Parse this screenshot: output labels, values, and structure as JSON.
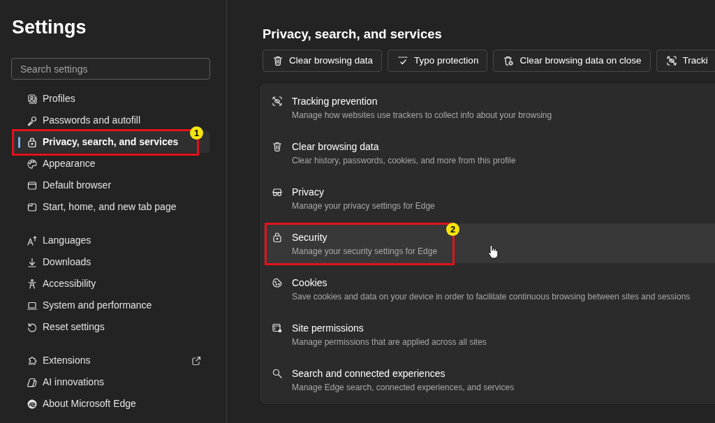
{
  "sidebar": {
    "title": "Settings",
    "search": {
      "placeholder": "Search settings"
    },
    "groups": [
      {
        "items": [
          {
            "label": "Profiles",
            "selected": false,
            "external": false
          },
          {
            "label": "Passwords and autofill",
            "selected": false,
            "external": false
          },
          {
            "label": "Privacy, search, and services",
            "selected": true,
            "external": false,
            "callout": "1"
          },
          {
            "label": "Appearance",
            "selected": false,
            "external": false
          },
          {
            "label": "Default browser",
            "selected": false,
            "external": false
          },
          {
            "label": "Start, home, and new tab page",
            "selected": false,
            "external": false
          }
        ]
      },
      {
        "items": [
          {
            "label": "Languages",
            "selected": false,
            "external": false
          },
          {
            "label": "Downloads",
            "selected": false,
            "external": false
          },
          {
            "label": "Accessibility",
            "selected": false,
            "external": false
          },
          {
            "label": "System and performance",
            "selected": false,
            "external": false
          },
          {
            "label": "Reset settings",
            "selected": false,
            "external": false
          }
        ]
      },
      {
        "items": [
          {
            "label": "Extensions",
            "selected": false,
            "external": true
          },
          {
            "label": "AI innovations",
            "selected": false,
            "external": false
          },
          {
            "label": "About Microsoft Edge",
            "selected": false,
            "external": false
          }
        ]
      }
    ]
  },
  "main": {
    "heading": "Privacy, search, and services",
    "quick_links": [
      {
        "label": "Clear browsing data"
      },
      {
        "label": "Typo protection"
      },
      {
        "label": "Clear browsing data on close"
      },
      {
        "label": "Tracki"
      }
    ],
    "rows": [
      {
        "title": "Tracking prevention",
        "description": "Manage how websites use trackers to collect info about your browsing",
        "hovered": false
      },
      {
        "title": "Clear browsing data",
        "description": "Clear history, passwords, cookies, and more from this profile",
        "hovered": false
      },
      {
        "title": "Privacy",
        "description": "Manage your privacy settings for Edge",
        "hovered": false
      },
      {
        "title": "Security",
        "description": "Manage your security settings for Edge",
        "hovered": true,
        "callout": "2"
      },
      {
        "title": "Cookies",
        "description": "Save cookies and data on your device in order to facilitate continuous browsing between sites and sessions",
        "hovered": false
      },
      {
        "title": "Site permissions",
        "description": "Manage permissions that are applied across all sites",
        "hovered": false
      },
      {
        "title": "Search and connected experiences",
        "description": "Manage Edge search, connected experiences, and services",
        "hovered": false
      }
    ]
  }
}
